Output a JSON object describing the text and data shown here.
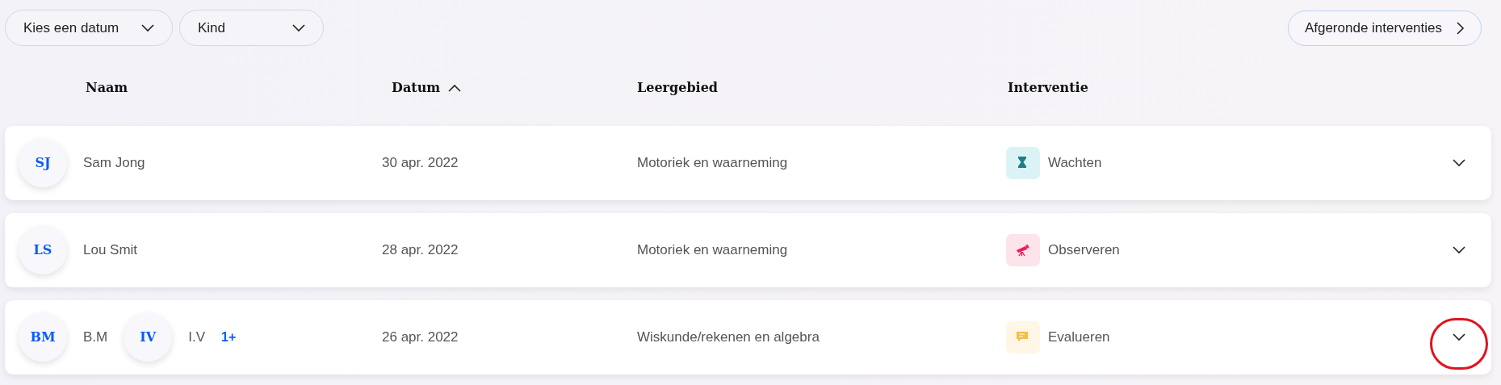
{
  "filters": [
    {
      "label": "Kies een datum"
    },
    {
      "label": "Kind"
    }
  ],
  "completed_button": {
    "label": "Afgeronde interventies"
  },
  "columns": [
    {
      "label": "Naam",
      "sorted": false
    },
    {
      "label": "Datum",
      "sorted": true
    },
    {
      "label": "Leergebied",
      "sorted": false
    },
    {
      "label": "Interventie",
      "sorted": false
    }
  ],
  "rows": [
    {
      "people": [
        {
          "initials": "SJ",
          "name": "Sam Jong"
        }
      ],
      "date": "30 apr. 2022",
      "area": "Motoriek en waarneming",
      "intervention": {
        "kind": "waiting",
        "label": "Wachten"
      },
      "circled": false
    },
    {
      "people": [
        {
          "initials": "LS",
          "name": "Lou Smit"
        }
      ],
      "date": "28 apr. 2022",
      "area": "Motoriek en waarneming",
      "intervention": {
        "kind": "observing",
        "label": "Observeren"
      },
      "circled": false
    },
    {
      "people": [
        {
          "initials": "BM",
          "name": "B.M"
        },
        {
          "initials": "IV",
          "name": "I.V"
        }
      ],
      "more": "1+",
      "date": "26 apr. 2022",
      "area": "Wiskunde/rekenen en algebra",
      "intervention": {
        "kind": "evaluating",
        "label": "Evalueren"
      },
      "circled": true
    }
  ]
}
